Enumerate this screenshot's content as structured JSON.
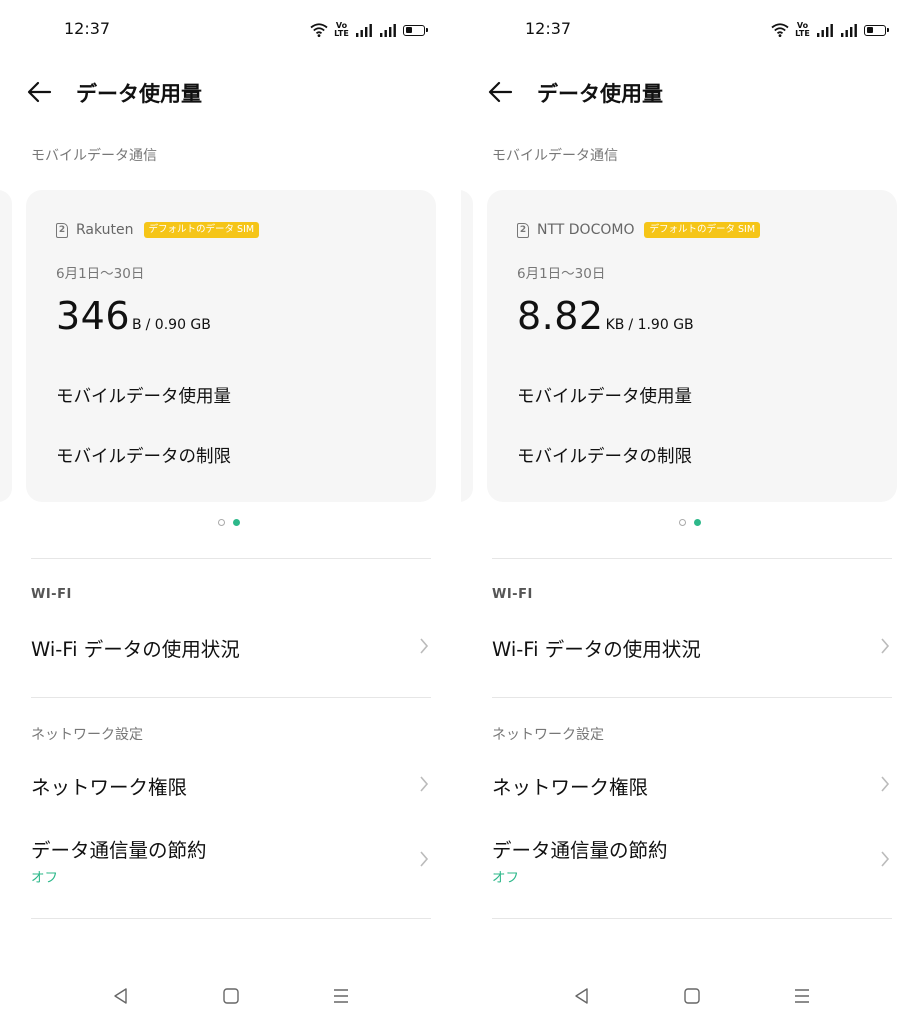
{
  "screens": [
    {
      "status": {
        "time": "12:37",
        "volte": "Vo\nLTE"
      },
      "header": {
        "title": "データ使用量"
      },
      "mobile_section": {
        "label": "モバイルデータ通信"
      },
      "card": {
        "sim_slot": "2",
        "carrier": "Rakuten",
        "badge": "デフォルトのデータ SIM",
        "period": "6月1日〜30日",
        "usage_value": "346",
        "usage_unit": "B",
        "usage_limit": "/ 0.90 GB",
        "link_usage": "モバイルデータ使用量",
        "link_limit": "モバイルデータの制限"
      },
      "pager": {
        "active_index": 1,
        "count": 2
      },
      "wifi_section": {
        "label": "WI-FI",
        "item": "Wi-Fi データの使用状況"
      },
      "network_section": {
        "label": "ネットワーク設定",
        "permissions": "ネットワーク権限",
        "saver": "データ通信量の節約",
        "saver_state": "オフ"
      }
    },
    {
      "status": {
        "time": "12:37",
        "volte": "Vo\nLTE"
      },
      "header": {
        "title": "データ使用量"
      },
      "mobile_section": {
        "label": "モバイルデータ通信"
      },
      "card": {
        "sim_slot": "2",
        "carrier": "NTT DOCOMO",
        "badge": "デフォルトのデータ SIM",
        "period": "6月1日〜30日",
        "usage_value": "8.82",
        "usage_unit": "KB",
        "usage_limit": "/ 1.90 GB",
        "link_usage": "モバイルデータ使用量",
        "link_limit": "モバイルデータの制限"
      },
      "pager": {
        "active_index": 1,
        "count": 2
      },
      "wifi_section": {
        "label": "WI-FI",
        "item": "Wi-Fi データの使用状況"
      },
      "network_section": {
        "label": "ネットワーク設定",
        "permissions": "ネットワーク権限",
        "saver": "データ通信量の節約",
        "saver_state": "オフ"
      }
    }
  ],
  "colors": {
    "accent": "#2db88a",
    "badge": "#f5c518",
    "card_bg": "#f6f6f6"
  },
  "icons": {
    "back": "arrow-left-icon",
    "chevron": "chevron-right-icon",
    "nav": [
      "nav-back-icon",
      "nav-home-icon",
      "nav-recents-icon"
    ]
  }
}
